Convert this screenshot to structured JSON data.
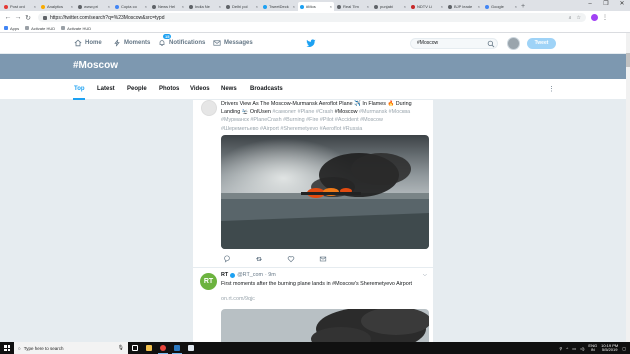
{
  "browser": {
    "tabs": [
      {
        "label": "Post ord",
        "color": "#e53935"
      },
      {
        "label": "Analytics",
        "color": "#f9ab00"
      },
      {
        "label": "www.pri",
        "color": "#5f6368"
      },
      {
        "label": "Copia co",
        "color": "#4285f4"
      },
      {
        "label": "News Hel",
        "color": "#5f6368"
      },
      {
        "label": "India Ne",
        "color": "#5f6368"
      },
      {
        "label": "Delhi pol",
        "color": "#5f6368"
      },
      {
        "label": "TweetDeck",
        "color": "#1da1f2"
      },
      {
        "label": "#Mos",
        "color": "#1da1f2"
      },
      {
        "label": "Real Tim",
        "color": "#5f6368"
      },
      {
        "label": "punjabi",
        "color": "#5f6368"
      },
      {
        "label": "NDTV Li",
        "color": "#c62828"
      },
      {
        "label": "BJP leade",
        "color": "#5f6368"
      },
      {
        "label": "Google",
        "color": "#4285f4"
      }
    ],
    "active_tab_index": 8,
    "url": "https://twitter.com/search?q=%23Moscow&src=typd",
    "window_controls": [
      "–",
      "❐",
      "✕"
    ],
    "bookmarks": [
      "Apps",
      "Activate HUD",
      "Activate HUD"
    ]
  },
  "twitter": {
    "nav": {
      "home": "Home",
      "moments": "Moments",
      "notifications": "Notifications",
      "notifications_badge": "15",
      "messages": "Messages"
    },
    "search_value": "#Moscow",
    "tweet_button": "Tweet",
    "banner_title": "#Moscow",
    "search_tabs": [
      "Top",
      "Latest",
      "People",
      "Photos",
      "Videos",
      "News",
      "Broadcasts"
    ],
    "active_search_tab": "Top",
    "more_icon": "⋮"
  },
  "tweets": [
    {
      "text_line1": "Drivers View As The Moscow-Murmansk Aeroflot Plane ✈️ In Flames 🔥 During",
      "text_line2_prefix": "Landing 🛬 OnlUsen ",
      "text_line2_tags": "#самолет #Plane #Crash",
      "text_line2_bold": " #Moscow ",
      "text_line2_tags2": "#Murmansk #Москва",
      "text_line3": "#Мурманск #PlaneCrash #Burning #Fire #Pilot #Accident #Moscow",
      "text_line4": "#Шереметьево #Airport #Sheremetyevo #Aeroflot #Russia"
    },
    {
      "author": "RT",
      "handle": "@RT_com",
      "time": "· 9m",
      "avatar_text": "RT",
      "text": "First moments after the burning plane lands in #Moscow's Sheremetyevo Airport",
      "link": "on.rt.com/9qjc"
    }
  ],
  "taskbar": {
    "search_placeholder": "Type here to search",
    "lang": "ENG",
    "region": "IN",
    "time": "10:19 PM",
    "date": "5/5/2019"
  }
}
